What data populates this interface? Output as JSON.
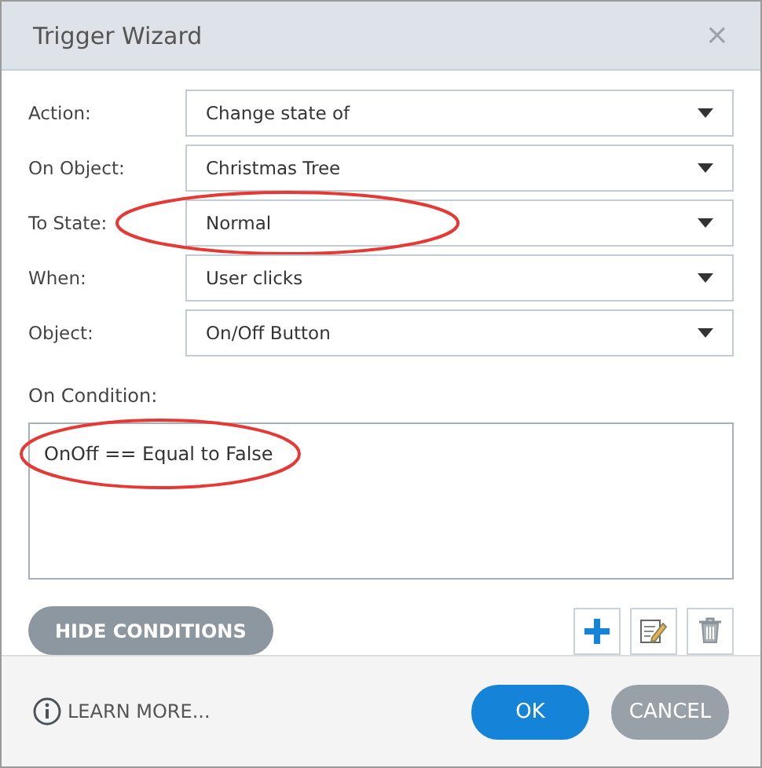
{
  "window": {
    "title": "Trigger Wizard",
    "close": "×"
  },
  "fields": [
    {
      "label": "Action:",
      "value": "Change state of",
      "circled": false
    },
    {
      "label": "On Object:",
      "value": "Christmas Tree",
      "circled": false
    },
    {
      "label": "To State:",
      "value": "Normal",
      "circled": true
    },
    {
      "label": "When:",
      "value": "User clicks",
      "circled": false
    },
    {
      "label": "Object:",
      "value": "On/Off Button",
      "circled": false
    }
  ],
  "condition": {
    "label": "On Condition:",
    "value": "OnOff == Equal to False",
    "circled": true
  },
  "hide_conditions": "HIDE CONDITIONS",
  "footer": {
    "learn_more": "LEARN MORE...",
    "ok": "OK",
    "cancel": "CANCEL"
  }
}
